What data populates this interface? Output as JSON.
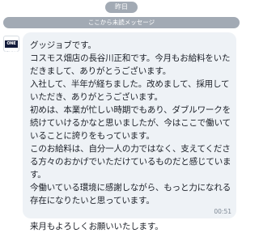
{
  "date_divider": "昨日",
  "unread_divider": "ここから未読メッセージ",
  "sender": {
    "avatar_text": "ONE PIECE",
    "avatar_icon": "one-piece-logo-icon"
  },
  "message": {
    "text": "グッジョブです。\nコスモス畑店の長谷川正和です。今月もお給料をいただきまして、ありがとうございます。\n入社して、半年が経ちました。改めまして、採用していただき、ありがとうございます。\n初めは、本業が忙しい時期でもあり、ダブルワークを続けていけるかなと思いましたが、今はここで働いていることに誇りをもっています。\nこのお給料は、自分一人の力ではなく、支えてくださる方々のおかげでいただけているものだと感じています。\n今働いている環境に感謝しながら、もっと力になれる存在になりたいと思っています。\n\n来月もよろしくお願いいたします。",
    "time": "00:51"
  },
  "colors": {
    "chip_bg": "#a2aab4",
    "bubble_bg": "#eef2f6",
    "text": "#1b1f27",
    "time": "#7d8793"
  }
}
